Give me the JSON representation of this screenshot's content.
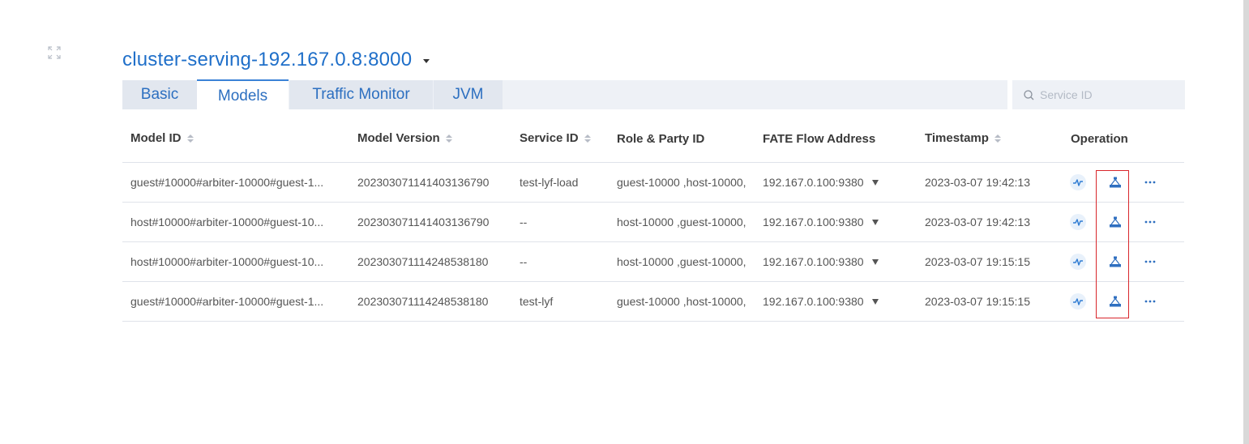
{
  "header": {
    "title": "cluster-serving-192.167.0.8:8000"
  },
  "tabs": [
    {
      "label": "Basic",
      "active": false
    },
    {
      "label": "Models",
      "active": true
    },
    {
      "label": "Traffic Monitor",
      "active": false
    },
    {
      "label": "JVM",
      "active": false
    }
  ],
  "search": {
    "placeholder": "Service ID",
    "value": ""
  },
  "table": {
    "columns": [
      {
        "label": "Model ID",
        "sortable": true
      },
      {
        "label": "Model Version",
        "sortable": true
      },
      {
        "label": "Service ID",
        "sortable": true
      },
      {
        "label": "Role & Party ID",
        "sortable": false
      },
      {
        "label": "FATE Flow Address",
        "sortable": false
      },
      {
        "label": "Timestamp",
        "sortable": true
      },
      {
        "label": "Operation",
        "sortable": false
      }
    ],
    "rows": [
      {
        "model_id": "guest#10000#arbiter-10000#guest-1...",
        "model_version": "202303071141403136790",
        "service_id": "test-lyf-load",
        "role_party": "guest-10000 ,host-10000,",
        "fate_flow": "192.167.0.100:9380",
        "timestamp": "2023-03-07 19:42:13"
      },
      {
        "model_id": "host#10000#arbiter-10000#guest-10...",
        "model_version": "202303071141403136790",
        "service_id": "--",
        "role_party": "host-10000 ,guest-10000,",
        "fate_flow": "192.167.0.100:9380",
        "timestamp": "2023-03-07 19:42:13"
      },
      {
        "model_id": "host#10000#arbiter-10000#guest-10...",
        "model_version": "202303071114248538180",
        "service_id": "--",
        "role_party": "host-10000 ,guest-10000,",
        "fate_flow": "192.167.0.100:9380",
        "timestamp": "2023-03-07 19:15:15"
      },
      {
        "model_id": "guest#10000#arbiter-10000#guest-1...",
        "model_version": "202303071114248538180",
        "service_id": "test-lyf",
        "role_party": "guest-10000 ,host-10000,",
        "fate_flow": "192.167.0.100:9380",
        "timestamp": "2023-03-07 19:15:15"
      }
    ]
  },
  "icons": {
    "expand": "expand-icon",
    "monitor": "pulse-icon",
    "topology": "topology-icon",
    "more": "more-icon",
    "search": "search-icon"
  },
  "colors": {
    "accent": "#1f6fc9",
    "highlight": "#d9262b",
    "tab_bg": "#e2e7ef"
  }
}
